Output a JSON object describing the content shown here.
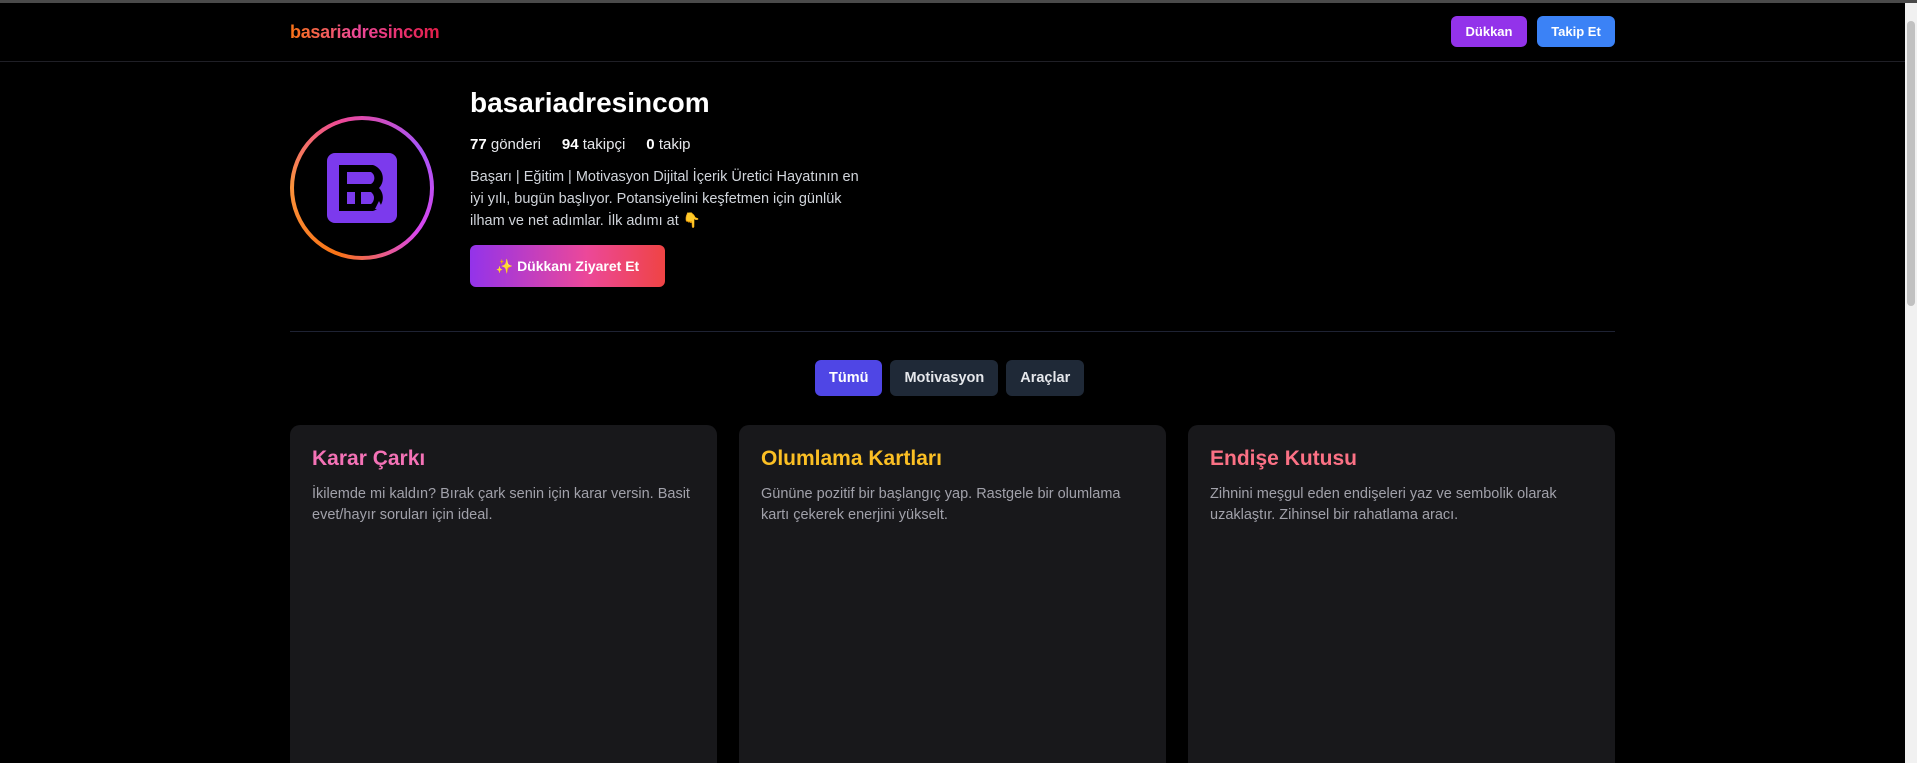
{
  "header": {
    "brand": "basariadresincom",
    "shop_button": "Dükkan",
    "follow_button": "Takip Et"
  },
  "profile": {
    "name": "basariadresincom",
    "stats": [
      {
        "count": "77",
        "label": "gönderi"
      },
      {
        "count": "94",
        "label": "takipçi"
      },
      {
        "count": "0",
        "label": "takip"
      }
    ],
    "bio": "Başarı | Eğitim | Motivasyon Dijital İçerik Üretici Hayatının en iyi yılı, bugün başlıyor. Potansiyelini keşfetmen için günlük ilham ve net adımlar. İlk adımı at 👇",
    "cta": "✨ Dükkanı Ziyaret Et"
  },
  "tabs": [
    {
      "label": "Tümü",
      "active": true
    },
    {
      "label": "Motivasyon",
      "active": false
    },
    {
      "label": "Araçlar",
      "active": false
    }
  ],
  "cards": [
    {
      "title": "Karar Çarkı",
      "desc": "İkilemde mi kaldın? Bırak çark senin için karar versin. Basit evet/hayır soruları için ideal.",
      "color": "#f472b6"
    },
    {
      "title": "Olumlama Kartları",
      "desc": "Gününe pozitif bir başlangıç yap. Rastgele bir olumlama kartı çekerek enerjini yükselt.",
      "color": "#fbbf24"
    },
    {
      "title": "Endişe Kutusu",
      "desc": "Zihnini meşgul eden endişeleri yaz ve sembolik olarak uzaklaştır. Zihinsel bir rahatlama aracı.",
      "color": "#fb7185"
    }
  ],
  "colors": {
    "background": "#000000",
    "card": "#18181b",
    "tab_active": "#4f46e5",
    "tab_inactive": "#1f2937",
    "shop_button": "#9333ea",
    "follow_button": "#3b82f6",
    "logo": "#7c3aed"
  },
  "icons": {
    "avatar_logo": "bp-monogram-logo"
  }
}
